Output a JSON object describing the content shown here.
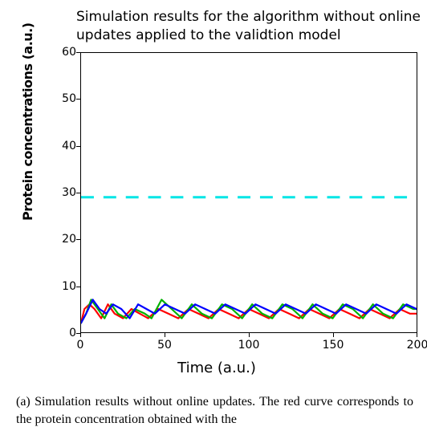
{
  "chart_data": {
    "type": "line",
    "title": "Simulation results for the algorithm without online updates applied to the validtion model",
    "xlabel": "Time (a.u.)",
    "ylabel": "Protein concentrations (a.u.)",
    "xlim": [
      0,
      200
    ],
    "ylim": [
      0,
      60
    ],
    "x_ticks": [
      0,
      50,
      100,
      150,
      200
    ],
    "y_ticks": [
      0,
      10,
      20,
      30,
      40,
      50,
      60
    ],
    "setpoint": {
      "style": "dashed",
      "color": "#00e5e5",
      "value": 29
    },
    "series": [
      {
        "name": "red (obtained protein concentration)",
        "color": "#ff0000",
        "x": [
          0,
          2,
          5,
          8,
          12,
          16,
          20,
          25,
          30,
          35,
          40,
          46,
          52,
          58,
          64,
          70,
          76,
          82,
          88,
          94,
          100,
          106,
          112,
          118,
          124,
          130,
          136,
          142,
          148,
          154,
          160,
          166,
          172,
          178,
          184,
          190,
          196,
          200
        ],
        "y": [
          2,
          5,
          6,
          5,
          3,
          6,
          4,
          3,
          5,
          4,
          3,
          5,
          4,
          3,
          5,
          4,
          3,
          5,
          4,
          3,
          5,
          4,
          3,
          5,
          4,
          3,
          5,
          4,
          3,
          5,
          4,
          3,
          5,
          4,
          3,
          5,
          4,
          4
        ]
      },
      {
        "name": "green",
        "color": "#00b200",
        "x": [
          0,
          3,
          6,
          10,
          14,
          18,
          22,
          27,
          32,
          38,
          42,
          48,
          54,
          60,
          66,
          72,
          78,
          84,
          90,
          96,
          102,
          108,
          114,
          120,
          126,
          132,
          138,
          144,
          150,
          156,
          162,
          168,
          174,
          180,
          186,
          192,
          198,
          200
        ],
        "y": [
          2,
          4,
          7,
          5,
          3,
          6,
          4,
          3,
          5,
          4,
          3,
          7,
          5,
          3,
          6,
          4,
          3,
          6,
          5,
          3,
          6,
          4,
          3,
          6,
          5,
          3,
          6,
          4,
          3,
          6,
          5,
          3,
          6,
          4,
          3,
          6,
          5,
          5
        ]
      },
      {
        "name": "blue",
        "color": "#0000ff",
        "x": [
          0,
          3,
          7,
          11,
          15,
          19,
          24,
          29,
          34,
          39,
          44,
          50,
          56,
          62,
          68,
          74,
          80,
          86,
          92,
          98,
          104,
          110,
          116,
          122,
          128,
          134,
          140,
          146,
          152,
          158,
          164,
          170,
          176,
          182,
          188,
          194,
          200
        ],
        "y": [
          2,
          4,
          7,
          5,
          4,
          6,
          5,
          3,
          6,
          5,
          4,
          6,
          5,
          4,
          6,
          5,
          4,
          6,
          5,
          4,
          6,
          5,
          4,
          6,
          5,
          4,
          6,
          5,
          4,
          6,
          5,
          4,
          6,
          5,
          4,
          6,
          5
        ]
      }
    ]
  },
  "caption": "(a)  Simulation results without online updates. The red curve corresponds to the protein concentration obtained with the"
}
